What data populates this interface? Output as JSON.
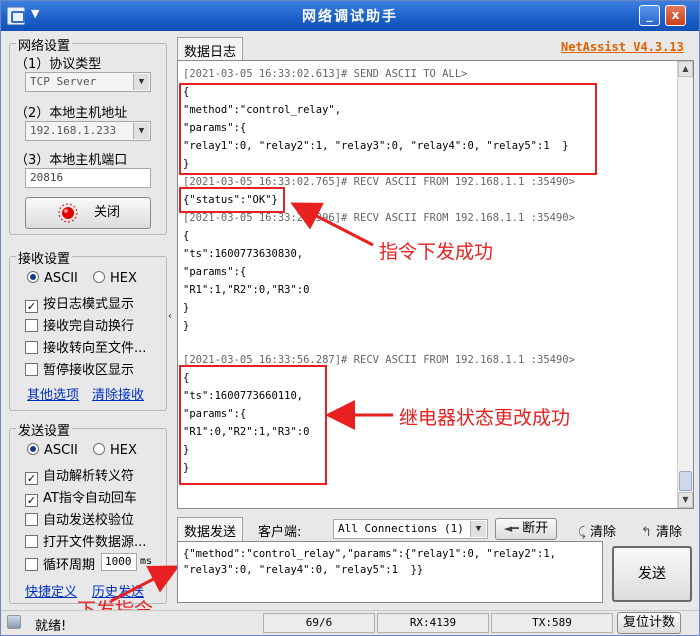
{
  "window": {
    "title": "网络调试助手",
    "menu_glyph": "▼",
    "minimize": "_",
    "close": "x"
  },
  "net_settings": {
    "title": "网络设置",
    "protocol_label": "（1）协议类型",
    "protocol_value": "TCP Server",
    "host_label": "（2）本地主机地址",
    "host_value": "192.168.1.233",
    "port_label": "（3）本地主机端口",
    "port_value": "20816",
    "close_button": "关闭"
  },
  "recv_settings": {
    "title": "接收设置",
    "ascii": "ASCII",
    "hex": "HEX",
    "options": [
      {
        "label": "按日志模式显示",
        "checked": true
      },
      {
        "label": "接收完自动换行",
        "checked": false
      },
      {
        "label": "接收转向至文件...",
        "checked": false
      },
      {
        "label": "暂停接收区显示",
        "checked": false
      }
    ],
    "link_other": "其他选项",
    "link_clear": "清除接收"
  },
  "send_settings": {
    "title": "发送设置",
    "ascii": "ASCII",
    "hex": "HEX",
    "options": [
      {
        "label": "自动解析转义符",
        "checked": true
      },
      {
        "label": "AT指令自动回车",
        "checked": true
      },
      {
        "label": "自动发送校验位",
        "checked": false
      },
      {
        "label": "打开文件数据源...",
        "checked": false
      }
    ],
    "loop_label": "循环周期",
    "loop_value": "1000",
    "loop_unit": "ms",
    "link_shortcut": "快捷定义",
    "link_history": "历史发送"
  },
  "log": {
    "tab": "数据日志",
    "brand": "NetAssist V4.3.13",
    "lines": [
      "[2021-03-05 16:33:02.613]# SEND ASCII TO ALL>",
      "{",
      "\"method\":\"control_relay\",",
      "\"params\":{",
      "\"relay1\":0, \"relay2\":1, \"relay3\":0, \"relay4\":0, \"relay5\":1  }",
      "}",
      "[2021-03-05 16:33:02.765]# RECV ASCII FROM 192.168.1.1 :35490>",
      "{\"status\":\"OK\"}",
      "[2021-03-05 16:33:26.396]# RECV ASCII FROM 192.168.1.1 :35490>",
      "{",
      "\"ts\":1600773630830,",
      "\"params\":{",
      "\"R1\":1,\"R2\":0,\"R3\":0",
      "}",
      "}",
      "[2021-03-05 16:33:56.287]# RECV ASCII FROM 192.168.1.1 :35490>",
      "{",
      "\"ts\":1600773660110,",
      "\"params\":{",
      "\"R1\":0,\"R2\":1,\"R3\":0",
      "}",
      "}"
    ]
  },
  "annotations": {
    "success": "指令下发成功",
    "relay_changed": "继电器状态更改成功",
    "send_cmd": "下发指令"
  },
  "send": {
    "tab": "数据发送",
    "client_label": "客户端:",
    "client_value": "All Connections (1)",
    "disconnect": "断开",
    "clear1": "清除",
    "clear2": "清除",
    "text_line1": "{\"method\":\"control_relay\",\"params\":{\"relay1\":0, \"relay2\":1,",
    "text_line2": "\"relay3\":0, \"relay4\":0, \"relay5\":1  }}",
    "send_button": "发送"
  },
  "status": {
    "ready": "就绪!",
    "counter": "69/6",
    "rx": "RX:4139",
    "tx": "TX:589",
    "reset": "复位计数"
  },
  "colors": {
    "annotation": "#e82020",
    "brand": "#e06000",
    "titlebar": "#1a5fc8"
  }
}
